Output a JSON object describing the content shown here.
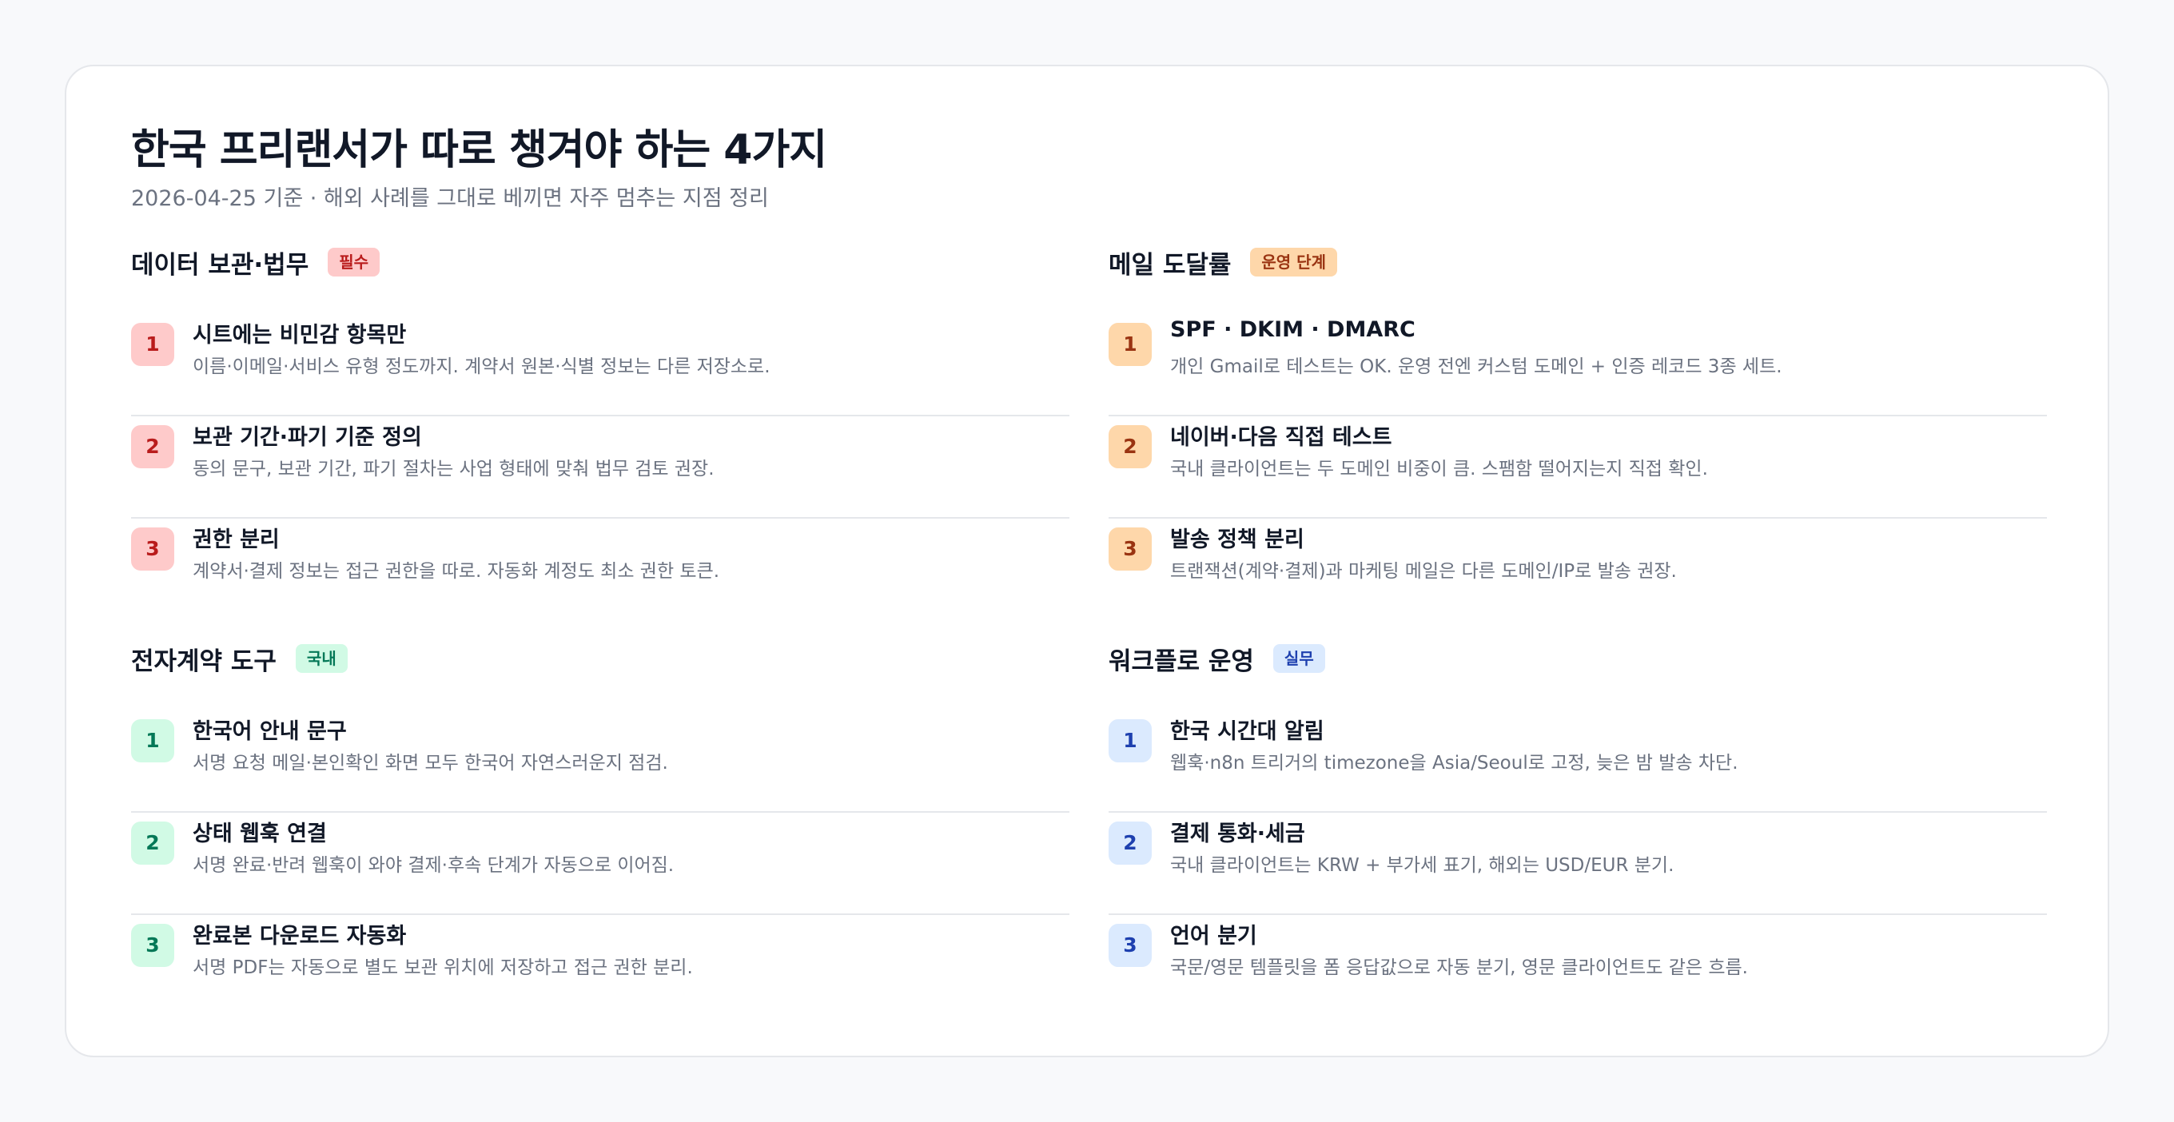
{
  "title": "한국 프리랜서가 따로 챙겨야 하는 4가지",
  "subtitle": "2026-04-25 기준 · 해외 사례를 그대로 베끼면 자주 멈추는 지점 정리",
  "sections": [
    {
      "title": "데이터 보관·법무",
      "badge": "필수",
      "color": "#fecaca",
      "items": [
        {
          "num": "1",
          "title": "시트에는 비민감 항목만",
          "desc": "이름·이메일·서비스 유형 정도까지. 계약서 원본·식별 정보는 다른 저장소로."
        },
        {
          "num": "2",
          "title": "보관 기간·파기 기준 정의",
          "desc": "동의 문구, 보관 기간, 파기 절차는 사업 형태에 맞춰 법무 검토 권장."
        },
        {
          "num": "3",
          "title": "권한 분리",
          "desc": "계약서·결제 정보는 접근 권한을 따로. 자동화 계정도 최소 권한 토큰."
        }
      ]
    },
    {
      "title": "메일 도달률",
      "badge": "운영 단계",
      "color": "#fed7aa",
      "items": [
        {
          "num": "1",
          "title": "SPF · DKIM · DMARC",
          "desc": "개인 Gmail로 테스트는 OK. 운영 전엔 커스텀 도메인 + 인증 레코드 3종 세트."
        },
        {
          "num": "2",
          "title": "네이버·다음 직접 테스트",
          "desc": "국내 클라이언트는 두 도메인 비중이 큼. 스팸함 떨어지는지 직접 확인."
        },
        {
          "num": "3",
          "title": "발송 정책 분리",
          "desc": "트랜잭션(계약·결제)과 마케팅 메일은 다른 도메인/IP로 발송 권장."
        }
      ]
    },
    {
      "title": "전자계약 도구",
      "badge": "국내",
      "color": "#d1fae5",
      "items": [
        {
          "num": "1",
          "title": "한국어 안내 문구",
          "desc": "서명 요청 메일·본인확인 화면 모두 한국어 자연스러운지 점검."
        },
        {
          "num": "2",
          "title": "상태 웹훅 연결",
          "desc": "서명 완료·반려 웹훅이 와야 결제·후속 단계가 자동으로 이어짐."
        },
        {
          "num": "3",
          "title": "완료본 다운로드 자동화",
          "desc": "서명 PDF는 자동으로 별도 보관 위치에 저장하고 접근 권한 분리."
        }
      ]
    },
    {
      "title": "워크플로 운영",
      "badge": "실무",
      "color": "#dbeafe",
      "items": [
        {
          "num": "1",
          "title": "한국 시간대 알림",
          "desc": "웹훅·n8n 트리거의 timezone을 Asia/Seoul로 고정, 늦은 밤 발송 차단."
        },
        {
          "num": "2",
          "title": "결제 통화·세금",
          "desc": "국내 클라이언트는 KRW + 부가세 표기, 해외는 USD/EUR 분기."
        },
        {
          "num": "3",
          "title": "언어 분기",
          "desc": "국문/영문 템플릿을 폼 응답값으로 자동 분기, 영문 클라이언트도 같은 흐름."
        }
      ]
    }
  ]
}
